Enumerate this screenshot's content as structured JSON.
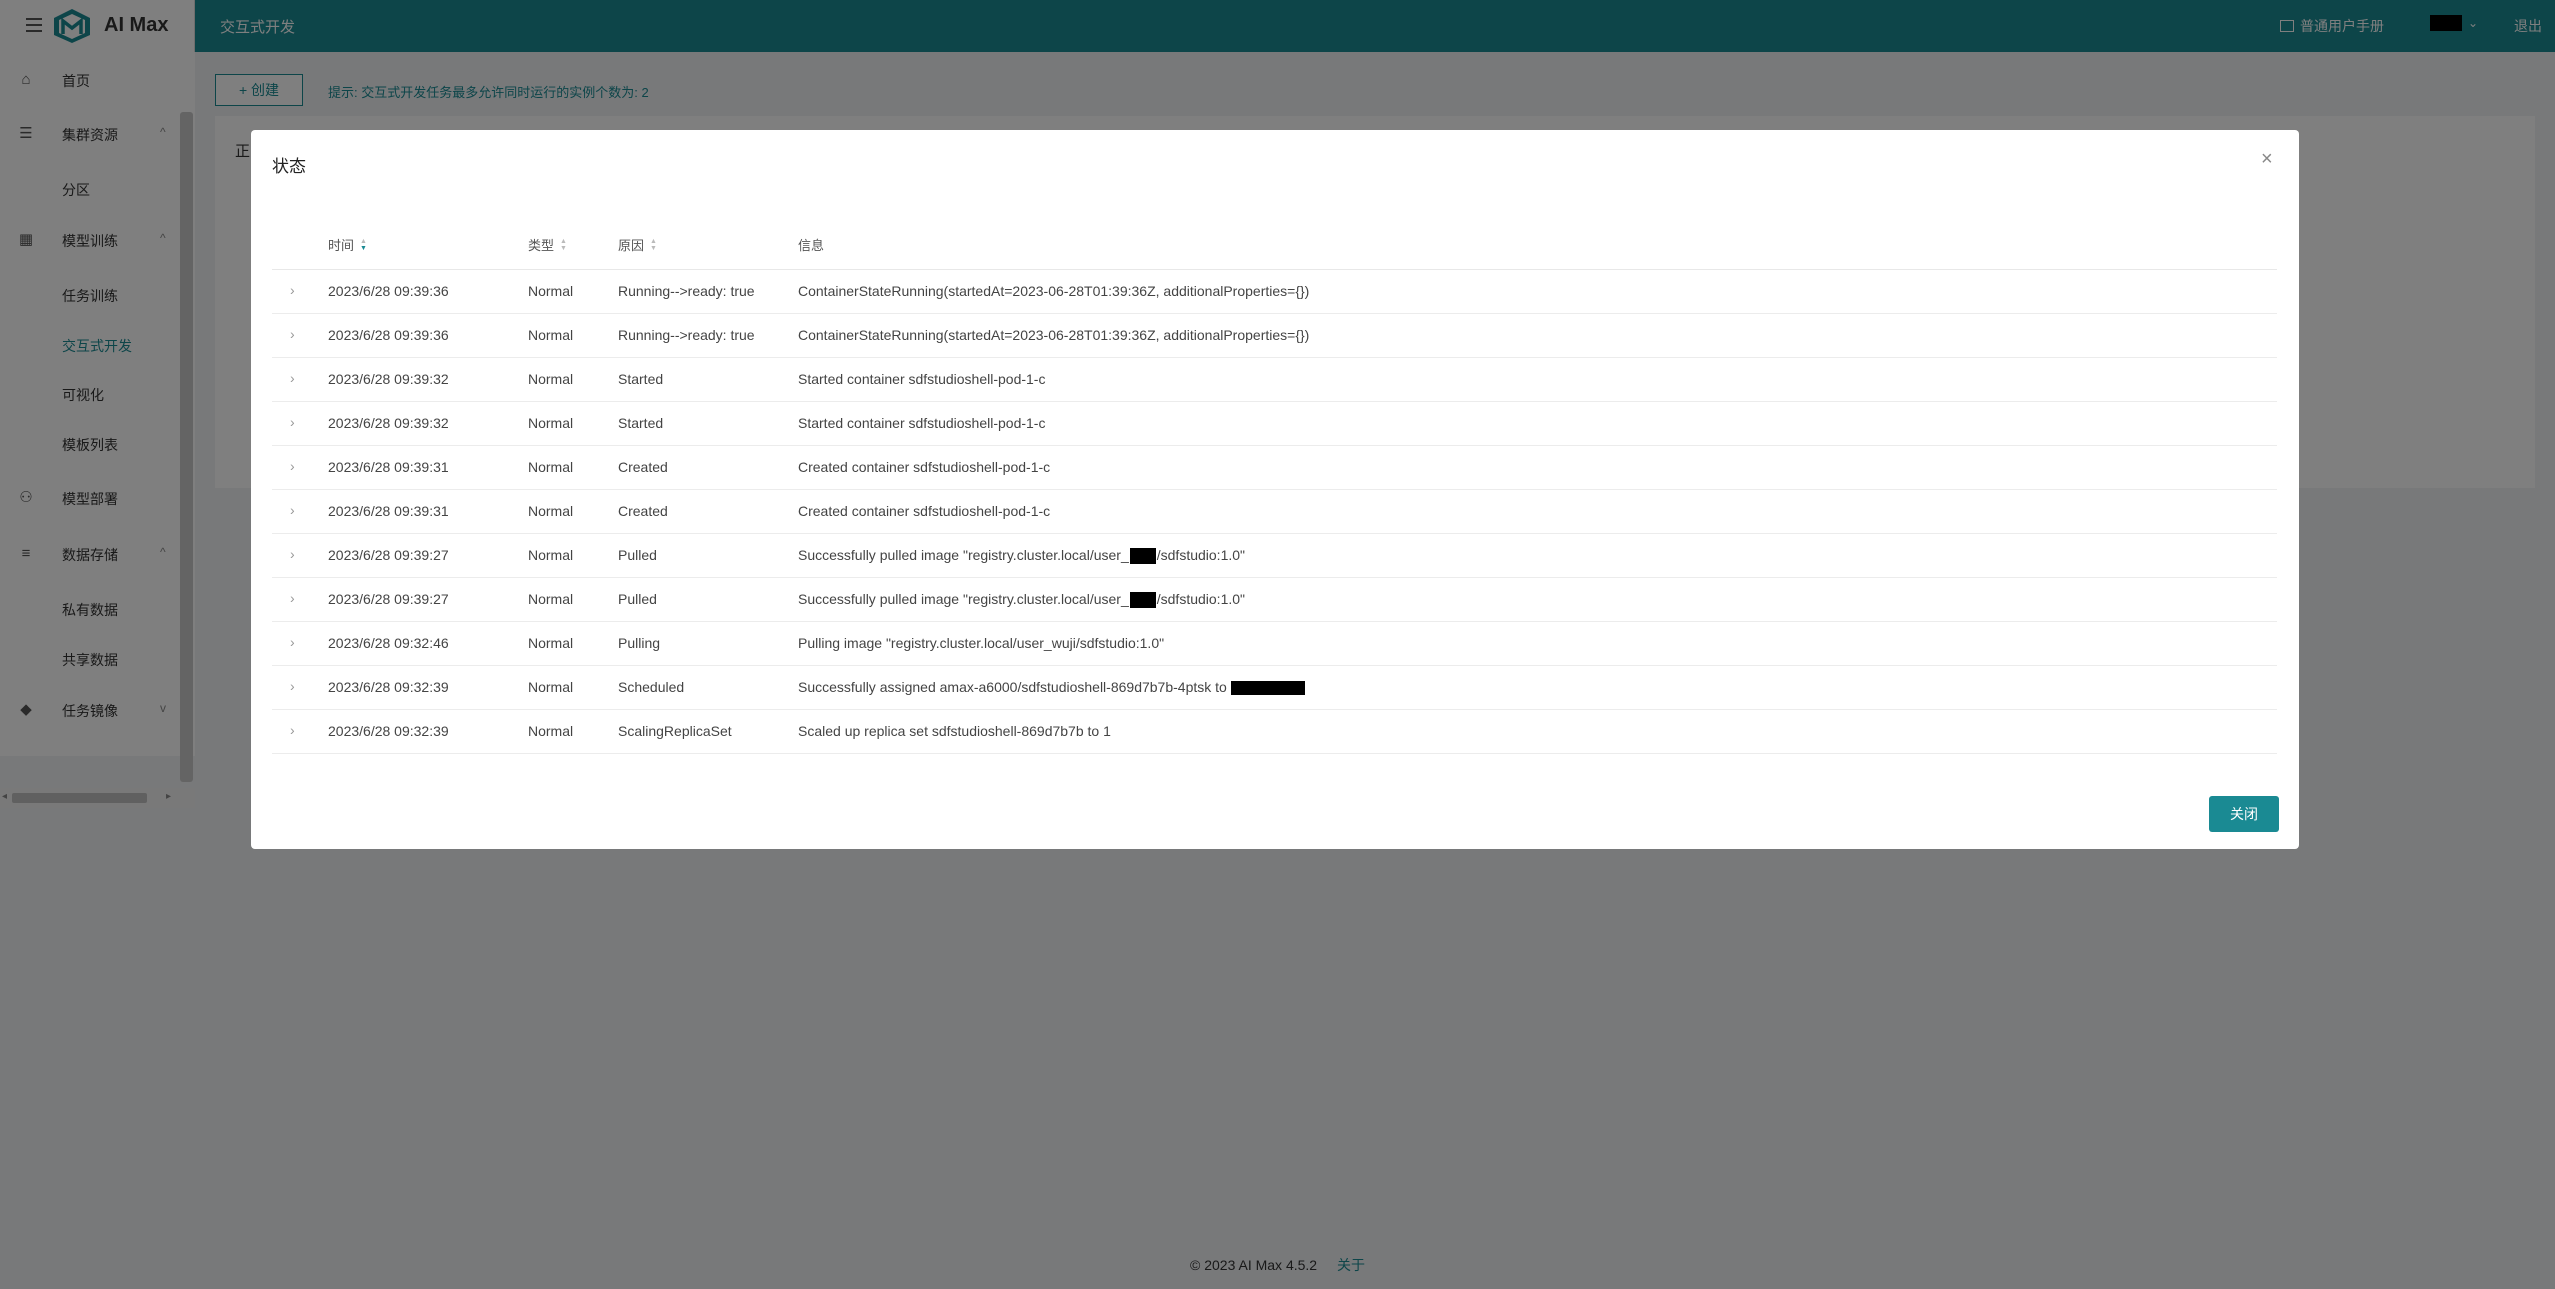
{
  "app": {
    "name": "AI Max",
    "page_title": "交互式开发",
    "manual_label": "普通用户手册",
    "logout_label": "退出",
    "accent_color": "#1a8a93"
  },
  "sidebar": {
    "home": "首页",
    "cluster": "集群资源",
    "partition": "分区",
    "model_training": "模型训练",
    "task_training": "任务训练",
    "interactive_dev": "交互式开发",
    "visualization": "可视化",
    "template_list": "模板列表",
    "model_deploy": "模型部署",
    "data_storage": "数据存储",
    "private_data": "私有数据",
    "shared_data": "共享数据",
    "task_image": "任务镜像"
  },
  "main": {
    "create_label": "+ 创建",
    "hint": "提示: 交互式开发任务最多允许同时运行的实例个数为: 2",
    "card_peek": "正"
  },
  "modal": {
    "title": "状态",
    "columns": {
      "time": "时间",
      "type": "类型",
      "reason": "原因",
      "info": "信息"
    },
    "rows": [
      {
        "time": "2023/6/28 09:39:36",
        "type": "Normal",
        "reason": "Running-->ready: true",
        "info": "ContainerStateRunning(startedAt=2023-06-28T01:39:36Z, additionalProperties={})"
      },
      {
        "time": "2023/6/28 09:39:36",
        "type": "Normal",
        "reason": "Running-->ready: true",
        "info": "ContainerStateRunning(startedAt=2023-06-28T01:39:36Z, additionalProperties={})"
      },
      {
        "time": "2023/6/28 09:39:32",
        "type": "Normal",
        "reason": "Started",
        "info": "Started container sdfstudioshell-pod-1-c"
      },
      {
        "time": "2023/6/28 09:39:32",
        "type": "Normal",
        "reason": "Started",
        "info": "Started container sdfstudioshell-pod-1-c"
      },
      {
        "time": "2023/6/28 09:39:31",
        "type": "Normal",
        "reason": "Created",
        "info": "Created container sdfstudioshell-pod-1-c"
      },
      {
        "time": "2023/6/28 09:39:31",
        "type": "Normal",
        "reason": "Created",
        "info": "Created container sdfstudioshell-pod-1-c"
      },
      {
        "time": "2023/6/28 09:39:27",
        "type": "Normal",
        "reason": "Pulled",
        "info_a": "Successfully pulled image \"registry.cluster.local/user_",
        "info_b": "/sdfstudio:1.0\""
      },
      {
        "time": "2023/6/28 09:39:27",
        "type": "Normal",
        "reason": "Pulled",
        "info_a": "Successfully pulled image \"registry.cluster.local/user_",
        "info_b": "/sdfstudio:1.0\""
      },
      {
        "time": "2023/6/28 09:32:46",
        "type": "Normal",
        "reason": "Pulling",
        "info": "Pulling image \"registry.cluster.local/user_wuji/sdfstudio:1.0\""
      },
      {
        "time": "2023/6/28 09:32:39",
        "type": "Normal",
        "reason": "Scheduled",
        "info": "Successfully assigned amax-a6000/sdfstudioshell-869d7b7b-4ptsk to"
      },
      {
        "time": "2023/6/28 09:32:39",
        "type": "Normal",
        "reason": "ScalingReplicaSet",
        "info": "Scaled up replica set sdfstudioshell-869d7b7b to 1"
      }
    ],
    "close_button": "关闭"
  },
  "footer": {
    "copyright": "© 2023 AI Max 4.5.2",
    "about": "关于"
  }
}
